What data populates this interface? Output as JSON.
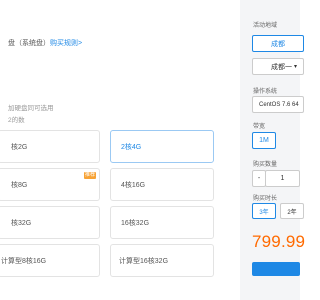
{
  "left": {
    "disk_text_prefix": "盘（系统盘）",
    "disk_link": "购买规则>",
    "rule_lines": [
      "",
      "加硬盘同可选用",
      "2的数"
    ]
  },
  "specs": [
    {
      "label": "核2G",
      "selected": false,
      "tag": ""
    },
    {
      "label": "2核4G",
      "selected": true,
      "tag": ""
    },
    {
      "label": "核8G",
      "selected": false,
      "tag": "推荐"
    },
    {
      "label": "4核16G",
      "selected": false,
      "tag": ""
    },
    {
      "label": "核32G",
      "selected": false,
      "tag": ""
    },
    {
      "label": "16核32G",
      "selected": false,
      "tag": ""
    },
    {
      "label": "计算型8核16G",
      "selected": false,
      "tag": ""
    },
    {
      "label": "计算型16核32G",
      "selected": false,
      "tag": ""
    }
  ],
  "panel": {
    "region_label": "活动地域",
    "region_options": [
      "成都",
      "成都一"
    ],
    "os_label": "操作系统",
    "os_value": "CentOS 7.6 64",
    "bandwidth_label": "带宽",
    "bandwidth_value": "1M",
    "quantity_label": "购买数量",
    "quantity_minus": "-",
    "quantity_value": "1",
    "duration_label": "购买时长",
    "duration_options": [
      "3年",
      "2年"
    ],
    "price": "799.99"
  },
  "colors": {
    "accent": "#1e88e5",
    "price": "#ff6a00",
    "tag": "#f7a234",
    "panel_bg": "#f4f5f7"
  },
  "icons": {
    "dropdown": "chevron-down-icon"
  }
}
